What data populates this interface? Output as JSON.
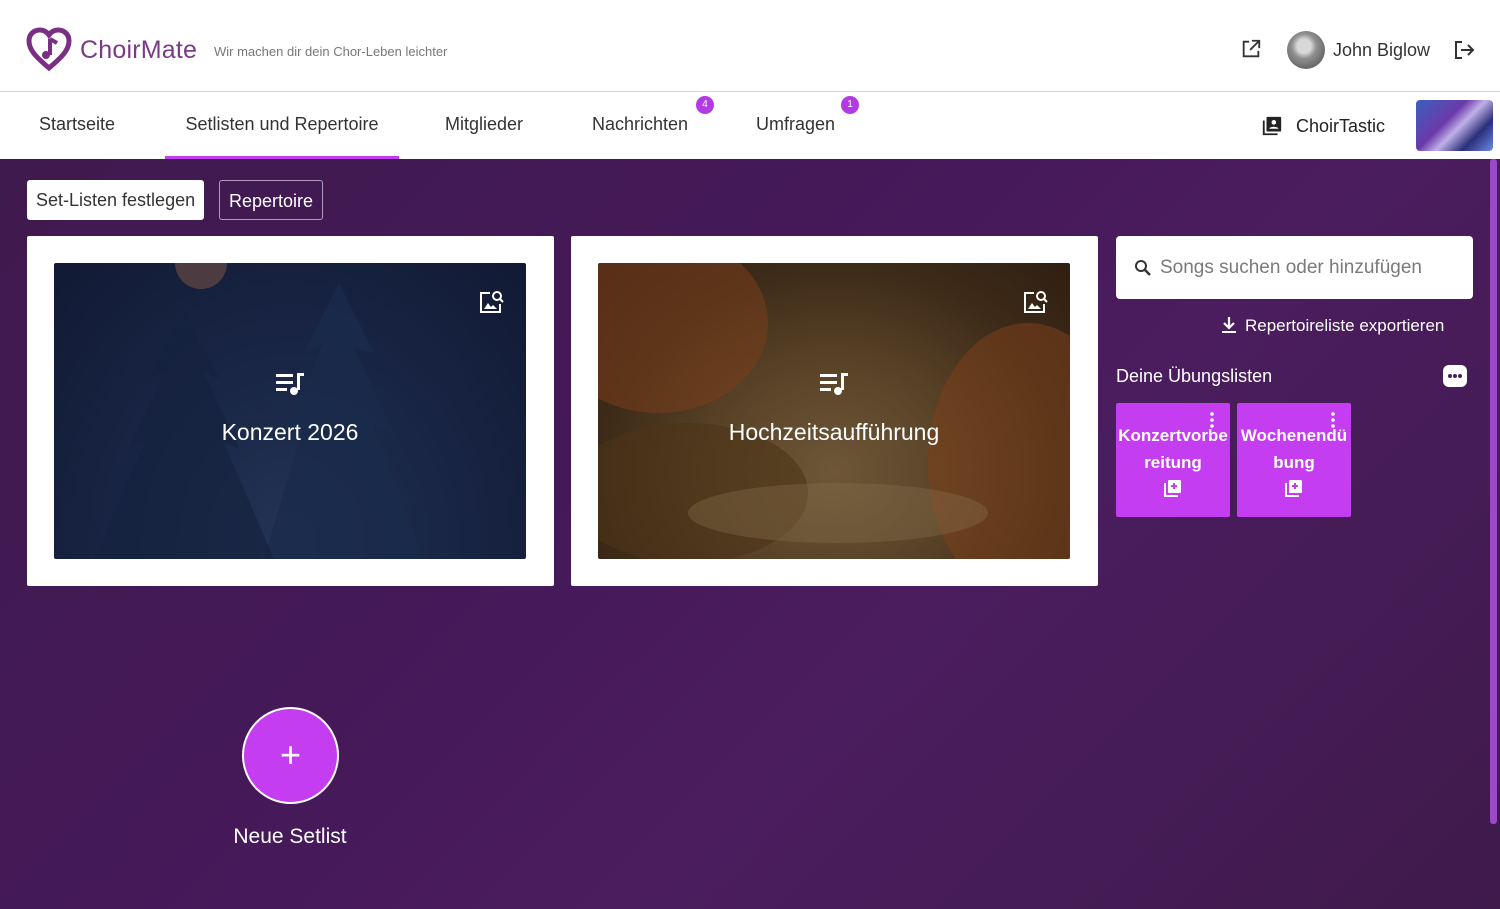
{
  "app": {
    "brand": "ChoirMate",
    "tagline": "Wir machen dir dein Chor-Leben leichter",
    "user_name": "John Biglow",
    "accent_color": "#c53df0"
  },
  "nav": {
    "tabs": [
      {
        "label": "Startseite"
      },
      {
        "label": "Setlisten und Repertoire",
        "active": true
      },
      {
        "label": "Mitglieder"
      },
      {
        "label": "Nachrichten",
        "badge": "4"
      },
      {
        "label": "Umfragen",
        "badge": "1"
      }
    ],
    "choir_name": "ChoirTastic"
  },
  "main": {
    "buttons": {
      "set_lists": "Set-Listen festlegen",
      "repertoire": "Repertoire"
    },
    "setlists": [
      {
        "title": "Konzert 2026"
      },
      {
        "title": "Hochzeitsaufführung"
      }
    ],
    "search": {
      "placeholder": "Songs suchen oder hinzufügen"
    },
    "export_label": "Repertoireliste exportieren",
    "practice": {
      "title": "Deine Übungslisten",
      "lists": [
        {
          "name": "Konzertvorbereitung"
        },
        {
          "name": "Wochenendübung"
        }
      ]
    },
    "new_setlist": {
      "plus": "+",
      "label": "Neue Setlist"
    }
  }
}
